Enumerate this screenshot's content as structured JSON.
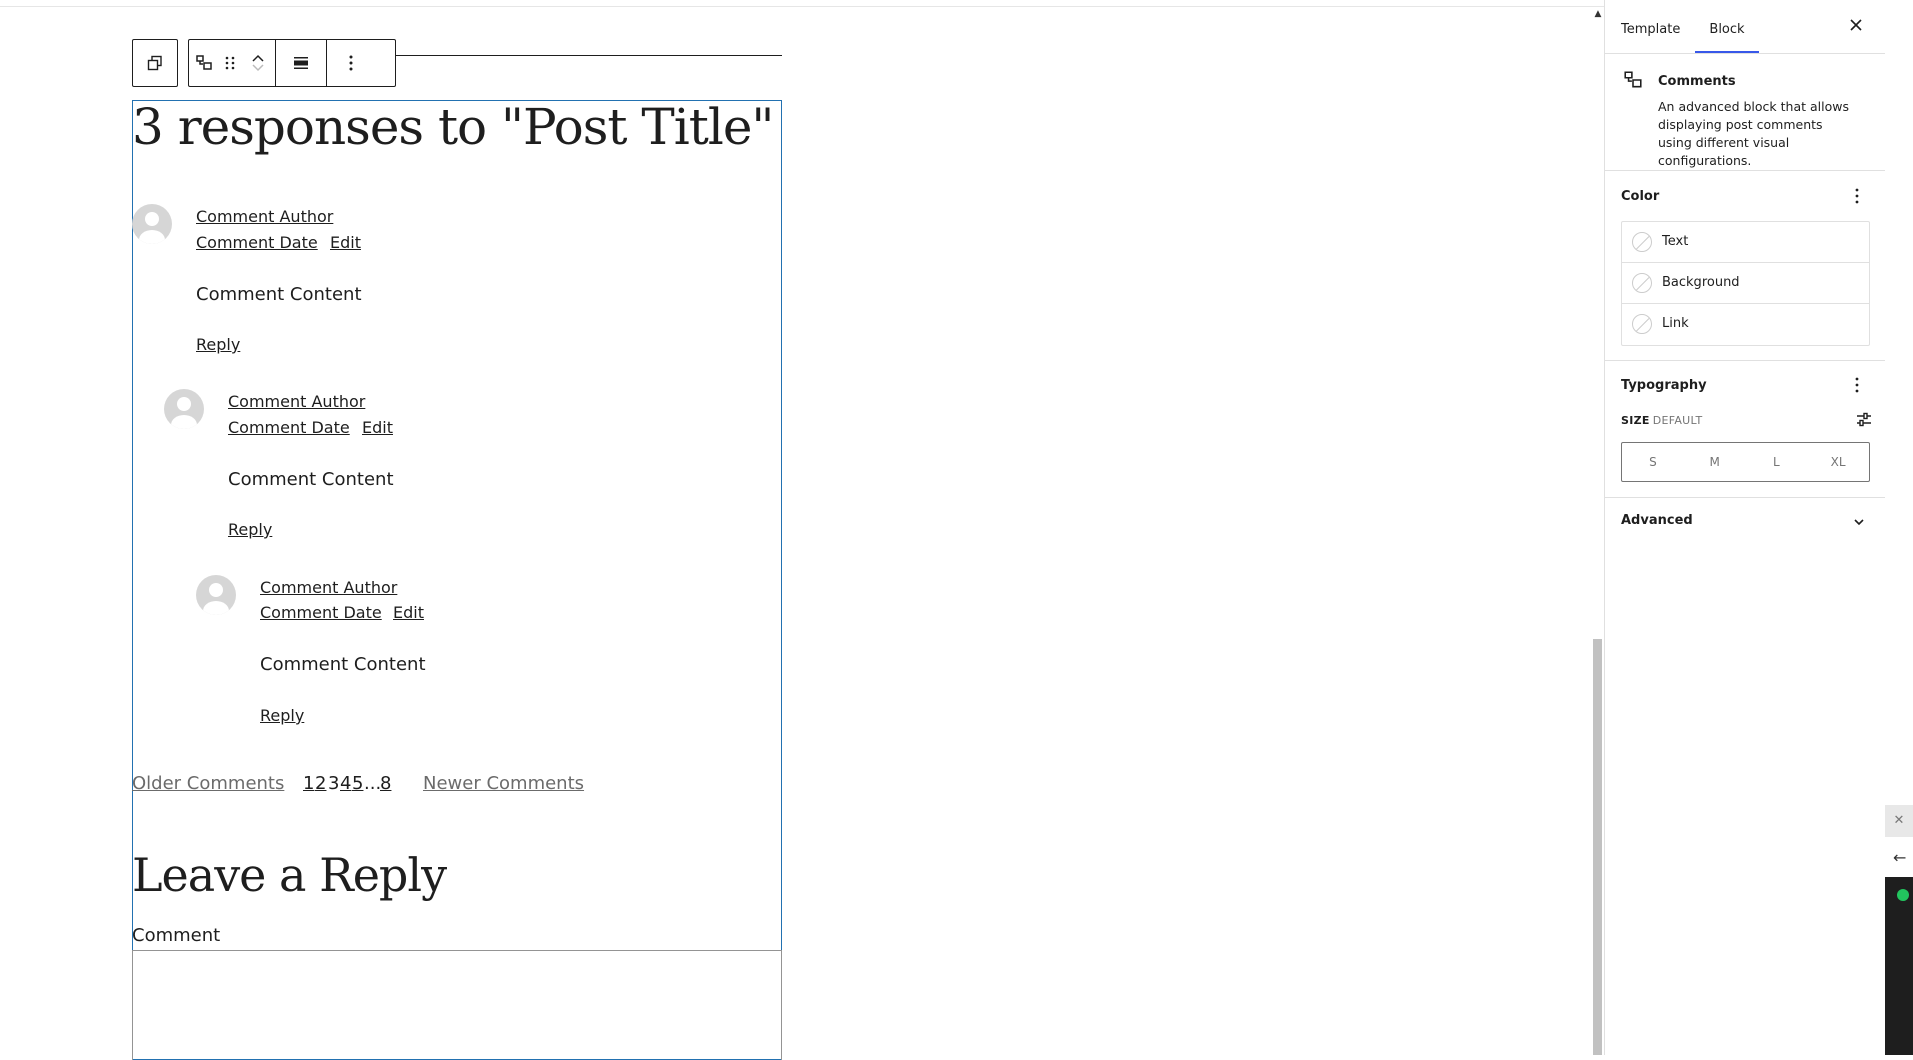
{
  "canvas": {
    "comments_title": "3 responses to \"Post Title\"",
    "comments": [
      {
        "author": "Comment Author",
        "date": "Comment Date",
        "edit": "Edit",
        "content": "Comment Content",
        "reply": "Reply"
      },
      {
        "author": "Comment Author",
        "date": "Comment Date",
        "edit": "Edit",
        "content": "Comment Content",
        "reply": "Reply"
      },
      {
        "author": "Comment Author",
        "date": "Comment Date",
        "edit": "Edit",
        "content": "Comment Content",
        "reply": "Reply"
      }
    ],
    "pagination": {
      "older": "Older Comments",
      "numbers": [
        "1",
        "2",
        "3",
        "4",
        "5",
        "...",
        "8"
      ],
      "newer": "Newer Comments"
    },
    "reply_title": "Leave a Reply",
    "comment_label": "Comment"
  },
  "sidebar": {
    "tabs": [
      {
        "label": "Template",
        "active": false
      },
      {
        "label": "Block",
        "active": true
      }
    ],
    "block_card": {
      "title": "Comments",
      "description": "An advanced block that allows displaying post comments using different visual configurations."
    },
    "color": {
      "title": "Color",
      "items": [
        "Text",
        "Background",
        "Link"
      ]
    },
    "typography": {
      "title": "Typography",
      "size_label": "SIZE",
      "size_value": "DEFAULT",
      "sizes": [
        "S",
        "M",
        "L",
        "XL"
      ]
    },
    "advanced": {
      "title": "Advanced"
    }
  },
  "colors": {
    "accent": "#3858e9",
    "block_border": "#2271b1",
    "text": "#1e1e1e",
    "muted": "#757575"
  }
}
